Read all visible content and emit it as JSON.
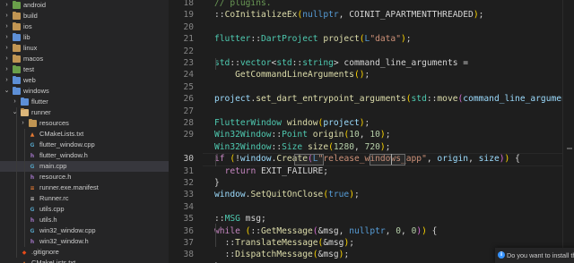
{
  "sidebar": {
    "items": [
      {
        "label": "android",
        "kind": "folder",
        "color": "green",
        "depth": 0,
        "expanded": false
      },
      {
        "label": "build",
        "kind": "folder",
        "color": "default",
        "depth": 0,
        "expanded": false
      },
      {
        "label": "ios",
        "kind": "folder",
        "color": "default",
        "depth": 0,
        "expanded": false
      },
      {
        "label": "lib",
        "kind": "folder",
        "color": "blue",
        "depth": 0,
        "expanded": false
      },
      {
        "label": "linux",
        "kind": "folder",
        "color": "default",
        "depth": 0,
        "expanded": false
      },
      {
        "label": "macos",
        "kind": "folder",
        "color": "default",
        "depth": 0,
        "expanded": false
      },
      {
        "label": "test",
        "kind": "folder",
        "color": "green",
        "depth": 0,
        "expanded": false
      },
      {
        "label": "web",
        "kind": "folder",
        "color": "blue",
        "depth": 0,
        "expanded": false
      },
      {
        "label": "windows",
        "kind": "folder",
        "color": "blue",
        "depth": 0,
        "expanded": true
      },
      {
        "label": "flutter",
        "kind": "folder",
        "color": "blue",
        "depth": 1,
        "expanded": false
      },
      {
        "label": "runner",
        "kind": "folder",
        "color": "default",
        "depth": 1,
        "expanded": true
      },
      {
        "label": "resources",
        "kind": "folder",
        "color": "default",
        "depth": 2,
        "expanded": false
      },
      {
        "label": "CMakeLists.txt",
        "kind": "file",
        "icon": "cmake-icon",
        "glyph": "▲",
        "depth": 2
      },
      {
        "label": "flutter_window.cpp",
        "kind": "file",
        "icon": "cpp-file-icon",
        "glyph": "G",
        "depth": 2
      },
      {
        "label": "flutter_window.h",
        "kind": "file",
        "icon": "h-file-icon",
        "glyph": "h",
        "depth": 2
      },
      {
        "label": "main.cpp",
        "kind": "file",
        "icon": "cpp-file-icon",
        "glyph": "G",
        "depth": 2,
        "selected": true
      },
      {
        "label": "resource.h",
        "kind": "file",
        "icon": "h-file-icon",
        "glyph": "h",
        "depth": 2
      },
      {
        "label": "runner.exe.manifest",
        "kind": "file",
        "icon": "manifest-icon",
        "glyph": "≡",
        "depth": 2
      },
      {
        "label": "Runner.rc",
        "kind": "file",
        "icon": "rc-file-icon",
        "glyph": "≡",
        "depth": 2
      },
      {
        "label": "utils.cpp",
        "kind": "file",
        "icon": "cpp-file-icon",
        "glyph": "G",
        "depth": 2
      },
      {
        "label": "utils.h",
        "kind": "file",
        "icon": "h-file-icon",
        "glyph": "h",
        "depth": 2
      },
      {
        "label": "win32_window.cpp",
        "kind": "file",
        "icon": "cpp-file-icon",
        "glyph": "G",
        "depth": 2
      },
      {
        "label": "win32_window.h",
        "kind": "file",
        "icon": "h-file-icon",
        "glyph": "h",
        "depth": 2
      },
      {
        "label": ".gitignore",
        "kind": "file",
        "icon": "git-icon",
        "glyph": "◆",
        "depth": 1
      },
      {
        "label": "CMakeLists.txt",
        "kind": "file",
        "icon": "cmake-icon",
        "glyph": "▲",
        "depth": 1
      }
    ]
  },
  "editor": {
    "active_line": 30,
    "lines": [
      {
        "n": "18",
        "tokens": [
          [
            "// plugins.",
            "cm"
          ]
        ]
      },
      {
        "n": "19",
        "tokens": [
          [
            "::",
            "p"
          ],
          [
            "CoInitializeEx",
            "fn"
          ],
          [
            "(",
            "br1"
          ],
          [
            "nullptr",
            "ty"
          ],
          [
            ", COINIT_APARTMENTTHREADED",
            "p"
          ],
          [
            ")",
            "br1"
          ],
          [
            ";",
            "p"
          ]
        ]
      },
      {
        "n": "20",
        "tokens": []
      },
      {
        "n": "21",
        "tokens": [
          [
            "flutter",
            "ns"
          ],
          [
            "::",
            "p"
          ],
          [
            "DartProject",
            "ns"
          ],
          [
            " ",
            "p"
          ],
          [
            "project",
            "fn"
          ],
          [
            "(",
            "br1"
          ],
          [
            "L",
            "ty"
          ],
          [
            "\"data\"",
            "str"
          ],
          [
            ")",
            "br1"
          ],
          [
            ";",
            "p"
          ]
        ]
      },
      {
        "n": "22",
        "tokens": []
      },
      {
        "n": "23",
        "tokens": [
          [
            "std",
            "ns"
          ],
          [
            "::",
            "p"
          ],
          [
            "vector",
            "ns"
          ],
          [
            "<",
            "p"
          ],
          [
            "std",
            "ns"
          ],
          [
            "::",
            "p"
          ],
          [
            "string",
            "ns"
          ],
          [
            ">",
            "p"
          ],
          [
            " command_line_arguments =",
            "p"
          ]
        ]
      },
      {
        "n": "24",
        "tokens": [
          [
            "    ",
            "p"
          ],
          [
            "GetCommandLineArguments",
            "fn"
          ],
          [
            "(",
            "br1"
          ],
          [
            ")",
            "br1"
          ],
          [
            ";",
            "p"
          ]
        ]
      },
      {
        "n": "25",
        "tokens": []
      },
      {
        "n": "26",
        "tokens": [
          [
            "project",
            "var"
          ],
          [
            ".",
            "p"
          ],
          [
            "set_dart_entrypoint_arguments",
            "fn"
          ],
          [
            "(",
            "br1"
          ],
          [
            "std",
            "ns"
          ],
          [
            "::",
            "p"
          ],
          [
            "move",
            "fn"
          ],
          [
            "(",
            "br2"
          ],
          [
            "command_line_arguments",
            "var"
          ],
          [
            ")",
            "br2"
          ],
          [
            ")",
            "br1"
          ],
          [
            ";",
            "p"
          ]
        ]
      },
      {
        "n": "27",
        "tokens": []
      },
      {
        "n": "28",
        "tokens": [
          [
            "FlutterWindow",
            "ns"
          ],
          [
            " ",
            "p"
          ],
          [
            "window",
            "fn"
          ],
          [
            "(",
            "br1"
          ],
          [
            "project",
            "var"
          ],
          [
            ")",
            "br1"
          ],
          [
            ";",
            "p"
          ]
        ]
      },
      {
        "n": "29",
        "tokens": [
          [
            "Win32Window",
            "ns"
          ],
          [
            "::",
            "p"
          ],
          [
            "Point",
            "ns"
          ],
          [
            " ",
            "p"
          ],
          [
            "origin",
            "fn"
          ],
          [
            "(",
            "br1"
          ],
          [
            "10",
            "num"
          ],
          [
            ", ",
            "p"
          ],
          [
            "10",
            "num"
          ],
          [
            ")",
            "br1"
          ],
          [
            ";",
            "p"
          ]
        ]
      },
      {
        "n": "29b",
        "tokens": [
          [
            "Win32Window",
            "ns"
          ],
          [
            "::",
            "p"
          ],
          [
            "Size",
            "ns"
          ],
          [
            " ",
            "p"
          ],
          [
            "size",
            "fn"
          ],
          [
            "(",
            "br1"
          ],
          [
            "1280",
            "num"
          ],
          [
            ", ",
            "p"
          ],
          [
            "720",
            "num"
          ],
          [
            ")",
            "br1"
          ],
          [
            ";",
            "p"
          ]
        ]
      },
      {
        "n": "30",
        "tokens": [
          [
            "if",
            "kw"
          ],
          [
            " ",
            "p"
          ],
          [
            "(",
            "br1"
          ],
          [
            "!",
            "p"
          ],
          [
            "window",
            "var"
          ],
          [
            ".",
            "p"
          ],
          [
            "Create",
            "fn"
          ],
          [
            "(",
            "br2"
          ],
          [
            "L",
            "ty"
          ],
          [
            "\"release_windows_app\"",
            "str"
          ],
          [
            ", ",
            "p"
          ],
          [
            "origin",
            "var"
          ],
          [
            ", ",
            "p"
          ],
          [
            "size",
            "var"
          ],
          [
            ")",
            "br2"
          ],
          [
            ")",
            "br1"
          ],
          [
            " {",
            "p"
          ]
        ]
      },
      {
        "n": "31",
        "tokens": [
          [
            "  ",
            "p"
          ],
          [
            "return",
            "kw"
          ],
          [
            " EXIT_FAILURE;",
            "p"
          ]
        ]
      },
      {
        "n": "32",
        "tokens": [
          [
            "}",
            "p"
          ]
        ]
      },
      {
        "n": "33",
        "tokens": [
          [
            "window",
            "var"
          ],
          [
            ".",
            "p"
          ],
          [
            "SetQuitOnClose",
            "fn"
          ],
          [
            "(",
            "br1"
          ],
          [
            "true",
            "ty"
          ],
          [
            ")",
            "br1"
          ],
          [
            ";",
            "p"
          ]
        ]
      },
      {
        "n": "34",
        "tokens": []
      },
      {
        "n": "35",
        "tokens": [
          [
            "::",
            "p"
          ],
          [
            "MSG",
            "ns"
          ],
          [
            " msg;",
            "p"
          ]
        ]
      },
      {
        "n": "36",
        "tokens": [
          [
            "while",
            "kw"
          ],
          [
            " ",
            "p"
          ],
          [
            "(",
            "br1"
          ],
          [
            "::",
            "p"
          ],
          [
            "GetMessage",
            "fn"
          ],
          [
            "(",
            "br2"
          ],
          [
            "&msg, ",
            "p"
          ],
          [
            "nullptr",
            "ty"
          ],
          [
            ", ",
            "p"
          ],
          [
            "0",
            "num"
          ],
          [
            ", ",
            "p"
          ],
          [
            "0",
            "num"
          ],
          [
            ")",
            "br2"
          ],
          [
            ")",
            "br1"
          ],
          [
            " {",
            "p"
          ]
        ]
      },
      {
        "n": "37",
        "tokens": [
          [
            "  ",
            "p"
          ],
          [
            "::",
            "p"
          ],
          [
            "TranslateMessage",
            "fn"
          ],
          [
            "(",
            "br1"
          ],
          [
            "&msg",
            "p"
          ],
          [
            ")",
            "br1"
          ],
          [
            ";",
            "p"
          ]
        ]
      },
      {
        "n": "38",
        "tokens": [
          [
            "  ",
            "p"
          ],
          [
            "::",
            "p"
          ],
          [
            "DispatchMessage",
            "fn"
          ],
          [
            "(",
            "br1"
          ],
          [
            "&msg",
            "p"
          ],
          [
            ")",
            "br1"
          ],
          [
            ";",
            "p"
          ]
        ]
      },
      {
        "n": "39",
        "tokens": [
          [
            "}",
            "p"
          ]
        ]
      }
    ],
    "line_numbers": [
      "18",
      "19",
      "20",
      "21",
      "22",
      "23",
      "24",
      "25",
      "26",
      "27",
      "28",
      "29",
      "",
      "30",
      "31",
      "32",
      "33",
      "34",
      "35",
      "36",
      "37",
      "38",
      "39"
    ]
  },
  "notification": {
    "message": "Do you want to install the"
  }
}
